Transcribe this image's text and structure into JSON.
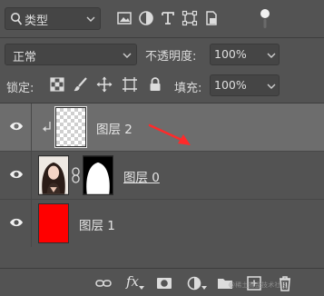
{
  "filter": {
    "label": "类型",
    "icons": [
      "image-filter-icon",
      "adjustment-filter-icon",
      "text-filter-icon",
      "shape-filter-icon",
      "smart-object-filter-icon"
    ]
  },
  "blend": {
    "mode": "正常",
    "opacity_label": "不透明度:",
    "opacity_value": "100%"
  },
  "lock": {
    "label": "锁定:",
    "icons": [
      "lock-transparent-icon",
      "lock-image-icon",
      "lock-position-icon",
      "lock-artboard-icon",
      "lock-all-icon"
    ],
    "fill_label": "填充:",
    "fill_value": "100%"
  },
  "layers": [
    {
      "name": "图层 2",
      "selected": true,
      "clipped": true,
      "thumb": "transparent"
    },
    {
      "name": "图层 0",
      "selected": false,
      "has_mask": true,
      "thumb": "portrait"
    },
    {
      "name": "图层 1",
      "selected": false,
      "thumb": "red"
    }
  ],
  "footer": {
    "icons": [
      "link-layers-icon",
      "fx-icon",
      "add-mask-icon",
      "adjustment-layer-icon",
      "new-group-icon",
      "new-layer-icon",
      "delete-icon"
    ],
    "fx_label": "fx",
    "watermark": "@稀土掘金技术社区"
  },
  "colors": {
    "panel": "#535353",
    "selected_row": "#6d6d6d",
    "red_layer": "#ff0000",
    "annotation": "#ff2a2a"
  }
}
